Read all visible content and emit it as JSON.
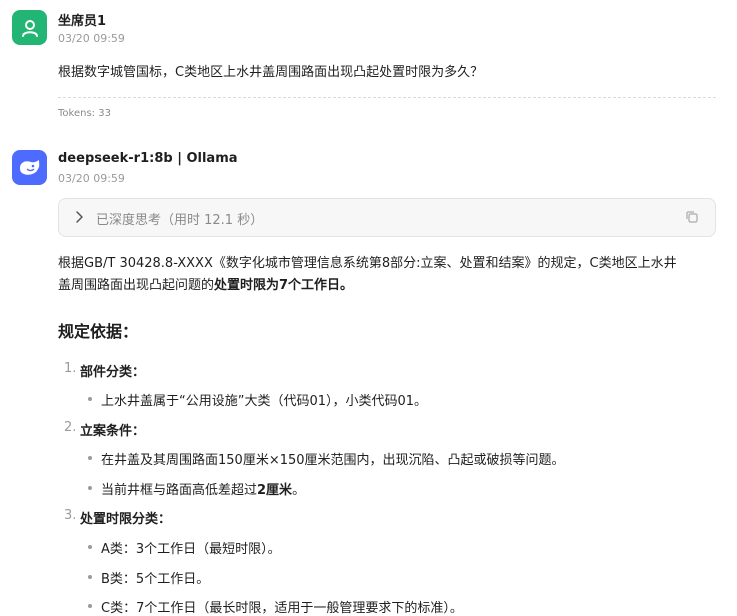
{
  "user_message": {
    "sender": "坐席员1",
    "time": "03/20 09:59",
    "text": "根据数字城管国标，C类地区上水井盖周围路面出现凸起处置时限为多久？",
    "tokens": "Tokens: 33"
  },
  "assistant_message": {
    "sender": "deepseek-r1:8b | Ollama",
    "time": "03/20 09:59",
    "thinking_label": "已深度思考（用时 12.1 秒）",
    "intro_part1": "根据GB/T 30428.8-XXXX《数字化城市管理信息系统第8部分:立案、处置和结案》的规定，C类地区上水井",
    "intro_part2": "盖周围路面出现凸起问题的",
    "intro_bold": "处置时限为7个工作日。",
    "heading": "规定依据：",
    "sections": [
      {
        "num": "1.",
        "title": "部件分类：",
        "items": [
          {
            "text": "上水井盖属于“公用设施”大类（代码01），小类代码01。"
          }
        ]
      },
      {
        "num": "2.",
        "title": "立案条件：",
        "items": [
          {
            "text": "在井盖及其周围路面150厘米×150厘米范围内，出现沉陷、凸起或破损等问题。"
          },
          {
            "text": "当前井框与路面高低差超过",
            "bold": "2厘米",
            "after": "。"
          }
        ]
      },
      {
        "num": "3.",
        "title": "处置时限分类：",
        "items": [
          {
            "text": "A类：3个工作日（最短时限）。"
          },
          {
            "text": "B类：5个工作日。"
          },
          {
            "text": "C类：7个工作日（最长时限，适用于一般管理要求下的标准）。"
          }
        ]
      }
    ]
  }
}
